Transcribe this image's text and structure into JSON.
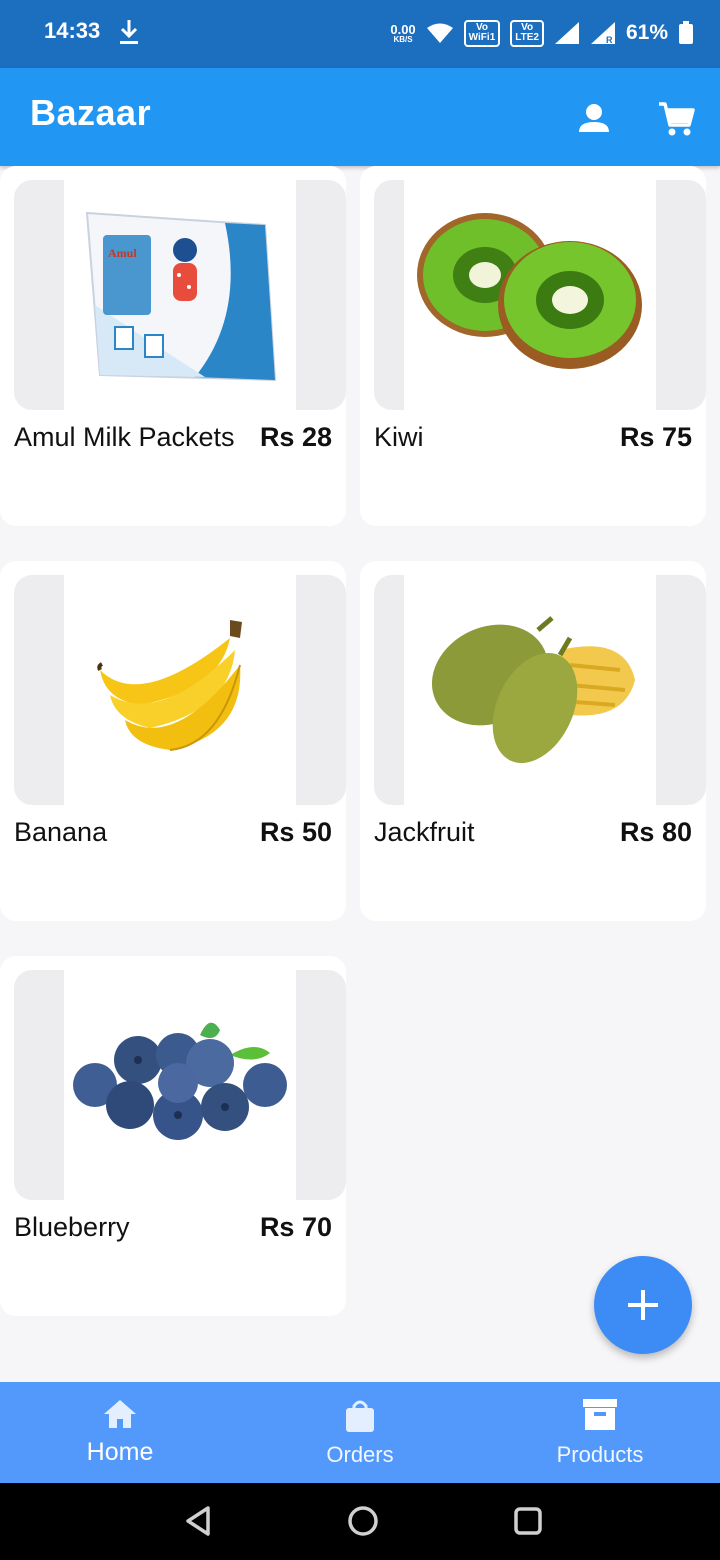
{
  "status_bar": {
    "time": "14:33",
    "speed_value": "0.00",
    "speed_unit": "KB/S",
    "tag_vowifi_top": "Vo",
    "tag_vowifi_bottom": "WiFi1",
    "tag_volte_top": "Vo",
    "tag_volte_bottom": "LTE2",
    "battery": "61%"
  },
  "app_bar": {
    "title": "Bazaar",
    "icons": [
      "person-icon",
      "shopping-cart-icon"
    ]
  },
  "products": [
    {
      "name": "Amul Milk Packets",
      "price": "Rs 28",
      "image": "milk-packet-image"
    },
    {
      "name": "Kiwi",
      "price": "Rs 75",
      "image": "kiwi-image"
    },
    {
      "name": "Banana",
      "price": "Rs 50",
      "image": "banana-image"
    },
    {
      "name": "Jackfruit",
      "price": "Rs 80",
      "image": "jackfruit-image"
    },
    {
      "name": "Blueberry",
      "price": "Rs 70",
      "image": "blueberry-image"
    }
  ],
  "fab": {
    "icon": "plus-icon"
  },
  "bottom_nav": {
    "items": [
      {
        "label": "Home",
        "icon": "home-icon",
        "active": true
      },
      {
        "label": "Orders",
        "icon": "shopping-bag-icon",
        "active": false
      },
      {
        "label": "Products",
        "icon": "archive-box-icon",
        "active": false
      }
    ]
  },
  "colors": {
    "status_bar": "#1c6fbf",
    "app_bar": "#2196f3",
    "bottom_nav": "#5399fb",
    "fab": "#3d8bf5",
    "background": "#f6f6f8"
  }
}
